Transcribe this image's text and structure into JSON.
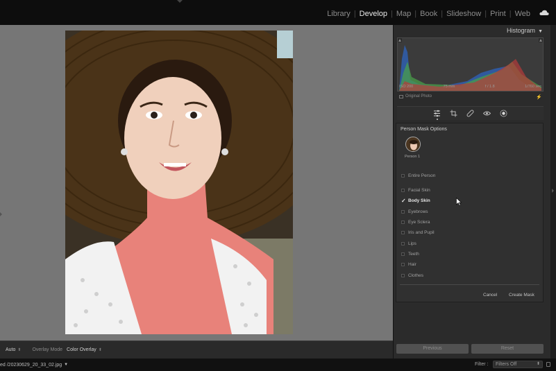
{
  "modules": {
    "items": [
      {
        "label": "Library",
        "active": false
      },
      {
        "label": "Develop",
        "active": true
      },
      {
        "label": "Map",
        "active": false
      },
      {
        "label": "Book",
        "active": false
      },
      {
        "label": "Slideshow",
        "active": false
      },
      {
        "label": "Print",
        "active": false
      },
      {
        "label": "Web",
        "active": false
      }
    ],
    "cloud_icon": "creative-cloud-icon"
  },
  "histogram": {
    "title": "Histogram",
    "iso": "ISO 200",
    "focal": "75 mm",
    "aperture": "f / 1.8",
    "shutter": "1/760 sec",
    "original_photo": "Original Photo"
  },
  "tools": [
    "edit-sliders-icon",
    "crop-icon",
    "healing-icon",
    "red-eye-icon",
    "masking-icon"
  ],
  "mask_options": {
    "title": "Person Mask Options",
    "person_label": "Person 1",
    "entire_person": "Entire Person",
    "items": [
      {
        "label": "Facial Skin",
        "checked": false
      },
      {
        "label": "Body Skin",
        "checked": true
      },
      {
        "label": "Eyebrows",
        "checked": false
      },
      {
        "label": "Eye Sclera",
        "checked": false
      },
      {
        "label": "Iris and Pupil",
        "checked": false
      },
      {
        "label": "Lips",
        "checked": false
      },
      {
        "label": "Teeth",
        "checked": false
      },
      {
        "label": "Hair",
        "checked": false
      },
      {
        "label": "Clothes",
        "checked": false
      }
    ],
    "cancel_label": "Cancel",
    "create_label": "Create Mask"
  },
  "panel_buttons": {
    "previous": "Previous",
    "reset": "Reset"
  },
  "toolbar": {
    "auto_label": "Auto",
    "overlay_mode_label": "Overlay Mode",
    "overlay_mode_value": "Color Overlay"
  },
  "status": {
    "filename": "ed /20230629_20_33_02.jpg",
    "filter_label": "Filter :",
    "filter_value": "Filters Off"
  },
  "colors": {
    "mask_overlay": "#e8827a",
    "accent_text": "#e9e9e9",
    "panel_bg": "#2b2b2b"
  }
}
